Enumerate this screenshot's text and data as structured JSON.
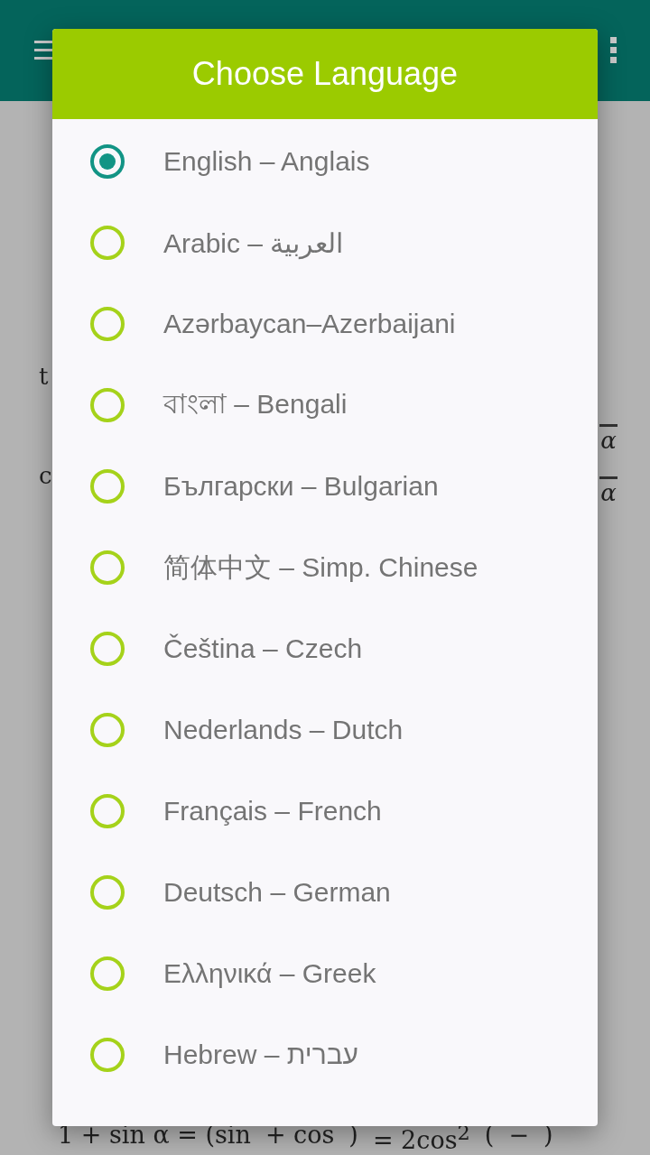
{
  "background": {
    "fragments": [
      "t",
      "c"
    ],
    "right_fragments": [
      "α",
      "α"
    ],
    "formula": [
      "1 + sin α = (sin",
      "+ cos",
      ")",
      "= 2cos$^{2}$",
      "(",
      "−",
      ")"
    ]
  },
  "dialog": {
    "title": "Choose Language",
    "options": [
      {
        "label": "English – Anglais",
        "selected": true
      },
      {
        "label": "Arabic – العربية",
        "selected": false
      },
      {
        "label": "Azərbaycan–Azerbaijani",
        "selected": false
      },
      {
        "label": "বাংলা – Bengali",
        "selected": false
      },
      {
        "label": "Български – Bulgarian",
        "selected": false
      },
      {
        "label": "简体中文 – Simp. Chinese",
        "selected": false
      },
      {
        "label": "Čeština – Czech",
        "selected": false
      },
      {
        "label": "Nederlands – Dutch",
        "selected": false
      },
      {
        "label": "Français – French",
        "selected": false
      },
      {
        "label": "Deutsch – German",
        "selected": false
      },
      {
        "label": "Ελληνικά – Greek",
        "selected": false
      },
      {
        "label": "Hebrew – עברית",
        "selected": false
      }
    ]
  }
}
